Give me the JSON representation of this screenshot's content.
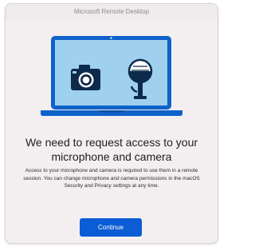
{
  "window": {
    "title": "Microsoft Remote Desktop"
  },
  "illustration": {
    "icons": [
      "laptop-icon",
      "camera-icon",
      "microphone-icon"
    ],
    "colors": {
      "screen": "#9fd0ee",
      "frame": "#0f62c9",
      "glyph": "#0e2a4a"
    }
  },
  "dialog": {
    "heading": "We need to request access to your microphone and camera",
    "body": "Access to your microphone and camera is required to use them in a remote session. You can change microphone and camera permissions in the macOS Security and Privacy settings at any time.",
    "continue_label": "Continue"
  },
  "colors": {
    "accent": "#0b5cd5",
    "background": "#f3eff1"
  }
}
